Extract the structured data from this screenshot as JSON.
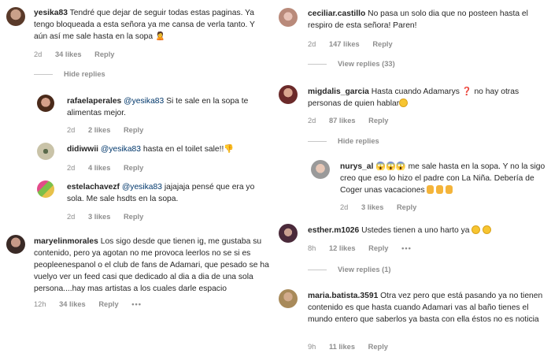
{
  "left": {
    "c1": {
      "user": "yesika83",
      "text": "Tendré que dejar de seguir todas estas paginas. Ya tengo bloqueada a esta señora ya me cansa de verla tanto. Y aún así me sale hasta en la sopa",
      "time": "2d",
      "likes": "34 likes",
      "reply": "Reply"
    },
    "hide1": "Hide replies",
    "r1": {
      "user": "rafaelaperales",
      "mention": "@yesika83",
      "text": " Si te sale en la sopa te alimentas mejor.",
      "time": "2d",
      "likes": "2 likes",
      "reply": "Reply"
    },
    "r2": {
      "user": "didiwwii",
      "mention": "@yesika83",
      "text": " hasta en el toilet sale!!",
      "time": "2d",
      "likes": "4 likes",
      "reply": "Reply"
    },
    "r3": {
      "user": "estelachavezf",
      "mention": "@yesika83",
      "text": " jajajaja pensé que era yo sola. Me sale hsdts en la sopa.",
      "time": "2d",
      "likes": "3 likes",
      "reply": "Reply"
    },
    "c2": {
      "user": "maryelinmorales",
      "text": " Los sigo desde que tienen ig, me gustaba su contenido, pero ya agotan no me provoca leerlos no se si es peopleenespanol o el club de fans de Adamari, que pesado se ha vuelyo ver un feed casi que dedicado al dia a dia de una sola persona....hay mas artistas a los cuales darle espacio",
      "time": "12h",
      "likes": "34 likes",
      "reply": "Reply",
      "more": "•••"
    }
  },
  "right": {
    "c1": {
      "user": "ceciliar.castillo",
      "text": " No pasa un solo dia que no posteen hasta el respiro de esta señora! Paren!",
      "time": "2d",
      "likes": "147 likes",
      "reply": "Reply"
    },
    "view1": "View replies (33)",
    "c2": {
      "user": "migdalis_garcia",
      "text": " Hasta cuando Adamarys ",
      "text2": " no hay otras personas de quien hablar",
      "time": "2d",
      "likes": "87 likes",
      "reply": "Reply"
    },
    "hide2": "Hide replies",
    "r1": {
      "user": "nurys_al",
      "text": " me sale hasta en la sopa. Y no la sigo creo que eso lo hizo el padre con La Niña. Debería de Coger unas vacaciones ",
      "time": "2d",
      "likes": "3 likes",
      "reply": "Reply"
    },
    "c3": {
      "user": "esther.m1026",
      "text": " Ustedes tienen a uno harto ya ",
      "time": "8h",
      "likes": "12 likes",
      "reply": "Reply",
      "more": "•••"
    },
    "view2": "View replies (1)",
    "c4": {
      "user": "maria.batista.3591",
      "text": " Otra vez pero que está pasando ya no tienen contenido es que hasta cuando Adamari vas al baño tienes el mundo entero que saberlos ya basta con ella éstos no es noticia",
      "time": "9h",
      "likes": "11 likes",
      "reply": "Reply"
    }
  },
  "colors": {
    "text": "#262626",
    "meta": "#8e8e8e",
    "mention": "#00376b"
  }
}
